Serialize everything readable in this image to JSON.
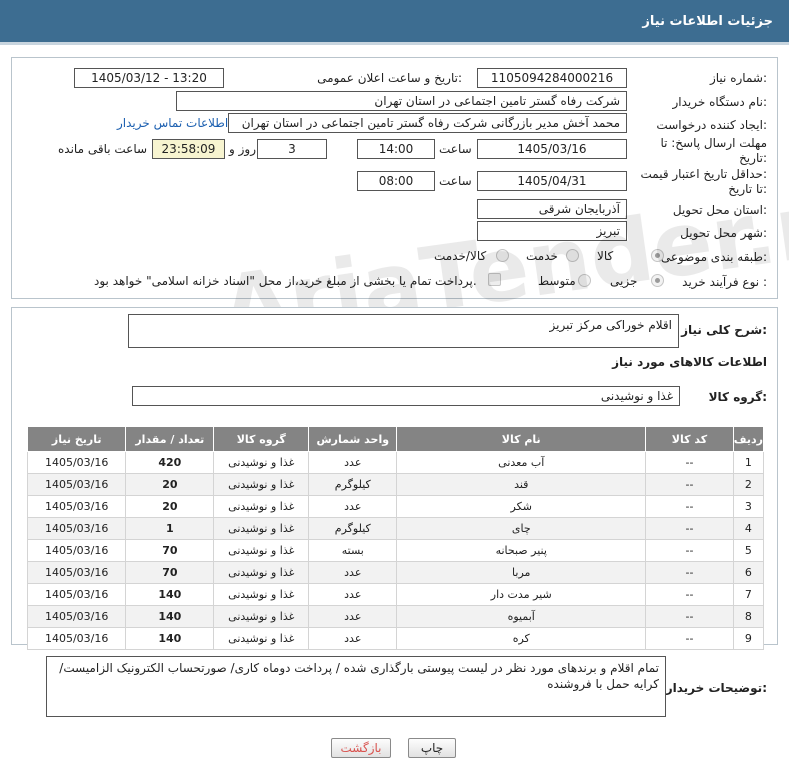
{
  "header": {
    "title": "جزئیات اطلاعات نیاز"
  },
  "form": {
    "need_number_label": "شماره نیاز:",
    "need_number": "1105094284000216",
    "announce_label": "تاریخ و ساعت اعلان عمومی:",
    "announce_value": "1405/03/12 - 13:20",
    "buyer_org_label": "نام دستگاه خریدار:",
    "buyer_org": "شرکت رفاه گستر تامین اجتماعی در استان تهران",
    "creator_label": "ایجاد کننده درخواست:",
    "creator": "محمد آخش مدیر بازرگانی شرکت رفاه گستر تامین اجتماعی در استان تهران",
    "contact_link": "اطلاعات تماس خریدار",
    "deadline_label_1": "مهلت ارسال پاسخ: تا",
    "deadline_label_2": "تاریخ:",
    "deadline_date": "1405/03/16",
    "time_word": "ساعت",
    "deadline_time": "14:00",
    "days_value": "3",
    "days_word": "روز و",
    "remaining_time": "23:58:09",
    "remaining_word": "ساعت باقی مانده",
    "validity_label_1": "حداقل تاریخ اعتبار قیمت:",
    "validity_label_2": "تا تاریخ:",
    "validity_date": "1405/04/31",
    "validity_time": "08:00",
    "province_label": "استان محل تحویل:",
    "province": "آذربایجان شرقی",
    "city_label": "شهر محل تحویل:",
    "city": "تبریز",
    "category_label": "طبقه بندی موضوعی:",
    "category_options": [
      "کالا",
      "خدمت",
      "کالا/خدمت"
    ],
    "purchase_type_label": "نوع فرآیند خرید :",
    "purchase_options": [
      "جزیی",
      "متوسط"
    ],
    "payment_note": "پرداخت تمام یا بخشی از مبلغ خرید،از محل \"اسناد خزانه اسلامی\" خواهد بود."
  },
  "summary": {
    "label": "شرح کلی نیاز:",
    "value": "اقلام خوراکی مرکز تبریز",
    "goods_info_title": "اطلاعات کالاهای مورد نیاز",
    "group_label": "گروه کالا:",
    "group_value": "غذا و نوشیدنی"
  },
  "table": {
    "headers": [
      "ردیف",
      "کد کالا",
      "نام کالا",
      "واحد شمارش",
      "گروه کالا",
      "تعداد / مقدار",
      "تاریخ نیاز"
    ],
    "rows": [
      [
        "1",
        "--",
        "آب معدنی",
        "عدد",
        "غذا و نوشیدنی",
        "420",
        "1405/03/16"
      ],
      [
        "2",
        "--",
        "قند",
        "کیلوگرم",
        "غذا و نوشیدنی",
        "20",
        "1405/03/16"
      ],
      [
        "3",
        "--",
        "شکر",
        "عدد",
        "غذا و نوشیدنی",
        "20",
        "1405/03/16"
      ],
      [
        "4",
        "--",
        "چای",
        "کیلوگرم",
        "غذا و نوشیدنی",
        "1",
        "1405/03/16"
      ],
      [
        "5",
        "--",
        "پنیر صبحانه",
        "بسته",
        "غذا و نوشیدنی",
        "70",
        "1405/03/16"
      ],
      [
        "6",
        "--",
        "مربا",
        "عدد",
        "غذا و نوشیدنی",
        "70",
        "1405/03/16"
      ],
      [
        "7",
        "--",
        "شیر مدت دار",
        "عدد",
        "غذا و نوشیدنی",
        "140",
        "1405/03/16"
      ],
      [
        "8",
        "--",
        "آبمیوه",
        "عدد",
        "غذا و نوشیدنی",
        "140",
        "1405/03/16"
      ],
      [
        "9",
        "--",
        "کره",
        "عدد",
        "غذا و نوشیدنی",
        "140",
        "1405/03/16"
      ]
    ]
  },
  "buyer_notes": {
    "label": "توضیحات خریدار:",
    "text": "تمام اقلام و برندهای مورد نظر در لیست پیوستی بارگذاری شده / پرداخت دوماه کاری/ صورتحساب الکترونیک الزامیست/ کرایه حمل با فروشنده"
  },
  "buttons": {
    "print": "چاپ",
    "back": "بازگشت"
  },
  "watermark": "AriaTender.net",
  "colors": {
    "title_bar": "#3d6d91",
    "table_header": "#848484",
    "link": "#1b5fb0",
    "back_text": "#d9534f"
  }
}
